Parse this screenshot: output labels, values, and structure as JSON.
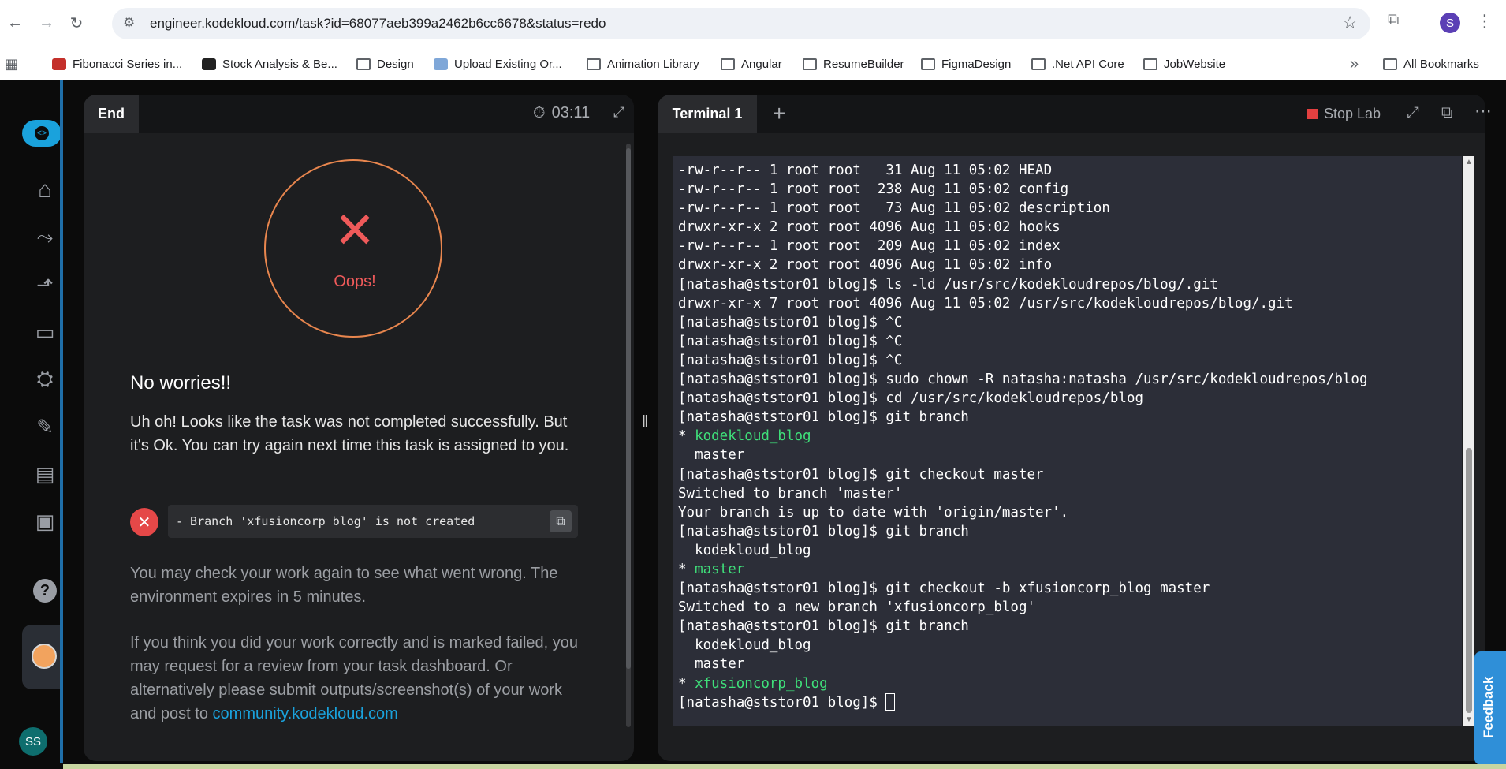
{
  "browser": {
    "url": "engineer.kodekloud.com/task?id=68077aeb399a2462b6cc6678&status=redo",
    "profile_initial": "S",
    "bookmarks": [
      {
        "label": "Fibonacci Series in...",
        "icon": "youtube-icon"
      },
      {
        "label": "Stock Analysis & Be...",
        "icon": "site-icon"
      },
      {
        "label": "Design",
        "icon": "folder-icon"
      },
      {
        "label": "Upload Existing Or...",
        "icon": "site-icon"
      },
      {
        "label": "Animation Library",
        "icon": "folder-icon"
      },
      {
        "label": "Angular",
        "icon": "folder-icon"
      },
      {
        "label": "ResumeBuilder",
        "icon": "folder-icon"
      },
      {
        "label": "FigmaDesign",
        "icon": "folder-icon"
      },
      {
        "label": ".Net API Core",
        "icon": "folder-icon"
      },
      {
        "label": "JobWebsite",
        "icon": "folder-icon"
      }
    ],
    "more_bookmarks": "»",
    "all_bookmarks": "All Bookmarks"
  },
  "sidebar": {
    "user_initials": "SS"
  },
  "left_panel": {
    "tab": "End",
    "timer": "03:11",
    "oops": "Oops!",
    "heading": "No worries!!",
    "message": "Uh oh! Looks like the task was not completed successfully. But it's Ok. You can try again next time this task is assigned to you.",
    "failure": "- Branch 'xfusioncorp_blog' is not created",
    "check_again": "You may check your work again to see what went wrong. The environment expires in 5 minutes.",
    "review_text": "If you think you did your work correctly and is marked failed, you may request for a review from your task dashboard. Or alternatively please submit outputs/screenshot(s) of your work and post to",
    "review_link": "community.kodekloud.com"
  },
  "right_panel": {
    "tab": "Terminal 1",
    "add_tab": "+",
    "stop_lab": "Stop Lab",
    "terminal_lines": [
      "-rw-r--r-- 1 root root   31 Aug 11 05:02 HEAD",
      "-rw-r--r-- 1 root root  238 Aug 11 05:02 config",
      "-rw-r--r-- 1 root root   73 Aug 11 05:02 description",
      "drwxr-xr-x 2 root root 4096 Aug 11 05:02 hooks",
      "-rw-r--r-- 1 root root  209 Aug 11 05:02 index",
      "drwxr-xr-x 2 root root 4096 Aug 11 05:02 info",
      "[natasha@ststor01 blog]$ ls -ld /usr/src/kodekloudrepos/blog/.git",
      "drwxr-xr-x 7 root root 4096 Aug 11 05:02 /usr/src/kodekloudrepos/blog/.git",
      "[natasha@ststor01 blog]$ ^C",
      "[natasha@ststor01 blog]$ ^C",
      "[natasha@ststor01 blog]$ ^C",
      "[natasha@ststor01 blog]$ sudo chown -R natasha:natasha /usr/src/kodekloudrepos/blog",
      "[natasha@ststor01 blog]$ cd /usr/src/kodekloudrepos/blog",
      "[natasha@ststor01 blog]$ git branch",
      "* |kodekloud_blog",
      "  master",
      "[natasha@ststor01 blog]$ git checkout master",
      "Switched to branch 'master'",
      "Your branch is up to date with 'origin/master'.",
      "[natasha@ststor01 blog]$ git branch",
      "  kodekloud_blog",
      "* |master",
      "[natasha@ststor01 blog]$ git checkout -b xfusioncorp_blog master",
      "Switched to a new branch 'xfusioncorp_blog'",
      "[natasha@ststor01 blog]$ git branch",
      "  kodekloud_blog",
      "  master",
      "* |xfusioncorp_blog",
      "[natasha@ststor01 blog]$ "
    ]
  },
  "feedback": "Feedback"
}
